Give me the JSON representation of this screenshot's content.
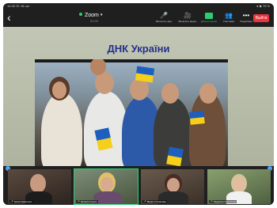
{
  "status_bar": {
    "time": "14:30 Пт 18 окт",
    "right": "● ◆ 75 %"
  },
  "header": {
    "back_icon": "‹",
    "meeting_title": "Zoom",
    "meeting_caret": "▾",
    "meeting_subtitle": "00:00"
  },
  "toolbar": {
    "items": [
      {
        "icon": "🎤",
        "label": "Включить звук"
      },
      {
        "icon": "🎥",
        "label": "Включить видео"
      },
      {
        "icon": "▲",
        "label": "Демонстрация"
      },
      {
        "icon": "👥",
        "label": "Участники"
      },
      {
        "icon": "•••",
        "label": "Подробнее"
      }
    ],
    "leave_label": "Выйти"
  },
  "slide": {
    "title": "ДНК України"
  },
  "participants": [
    {
      "name": "Ірина Кравченко"
    },
    {
      "name": "Наталія Сушко"
    },
    {
      "name": "Марія Степанова"
    },
    {
      "name": "Людмила Коваленко"
    }
  ],
  "colors": {
    "leave": "#e8353b",
    "active_speaker": "#2ecc71",
    "slide_title": "#26308a"
  }
}
